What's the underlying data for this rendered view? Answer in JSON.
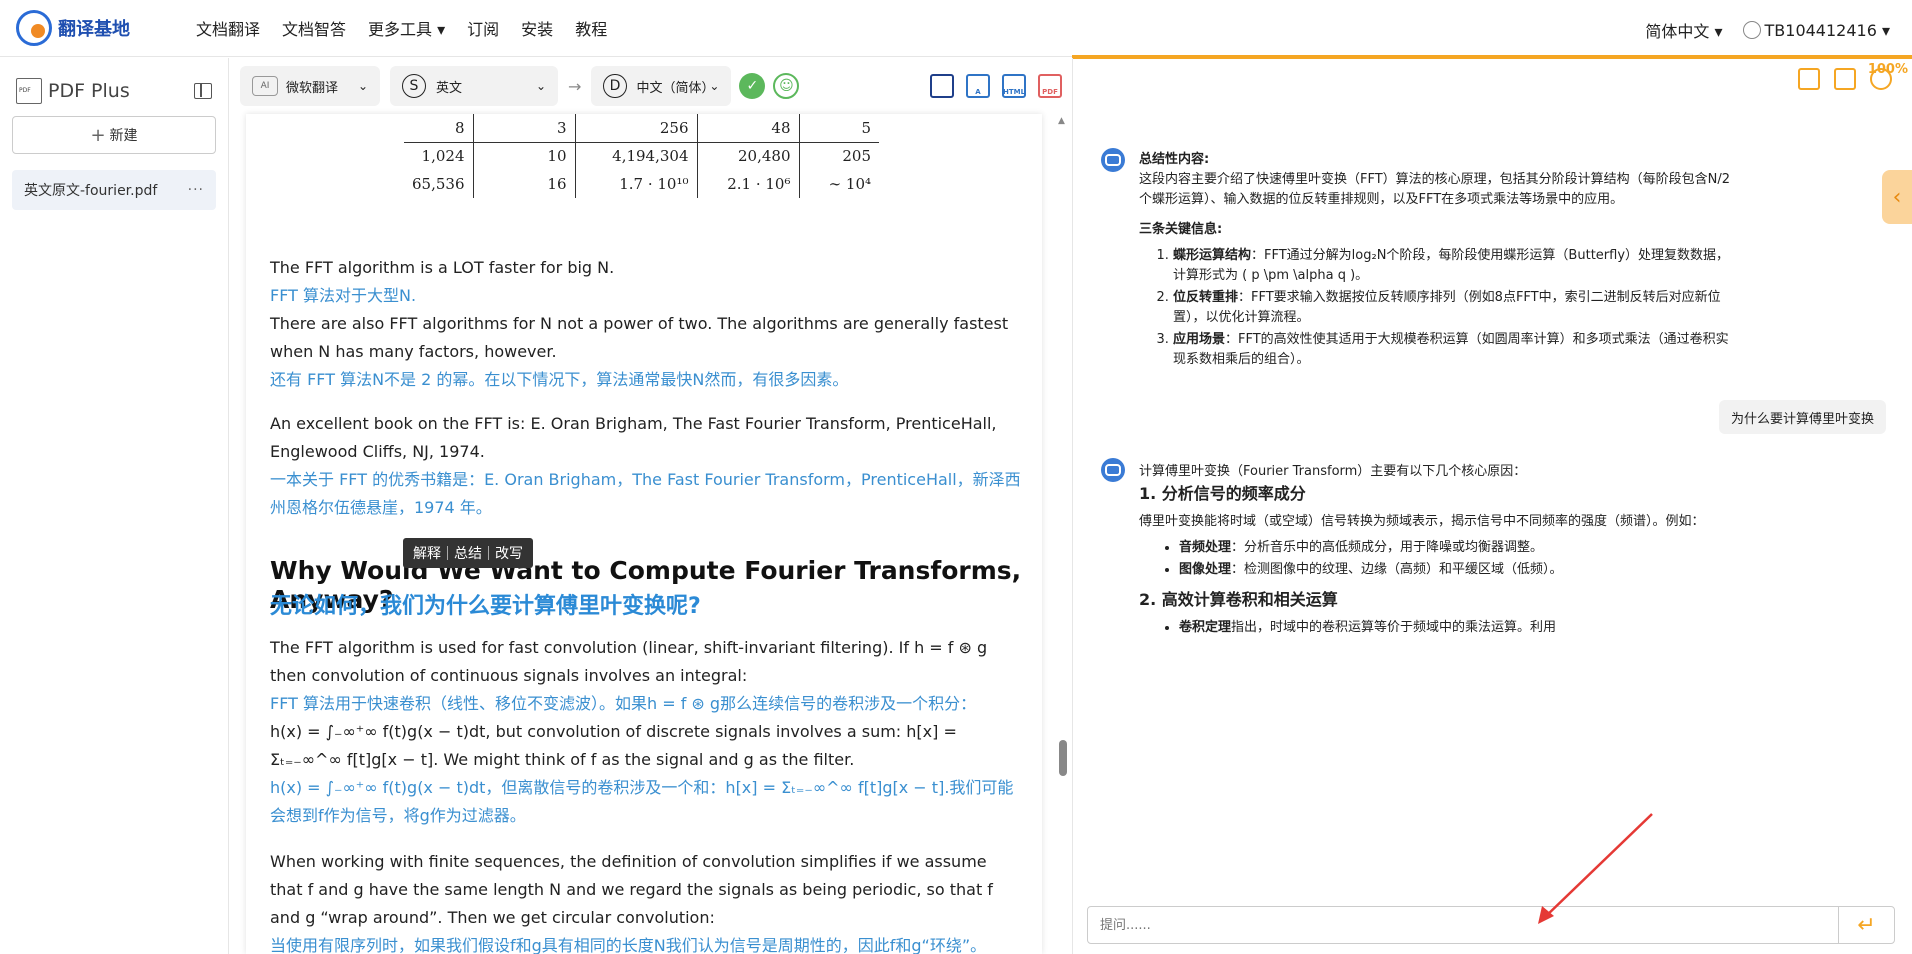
{
  "header": {
    "logo_text": "翻译基地",
    "nav": [
      "文档翻译",
      "文档智答",
      "更多工具 ▾",
      "订阅",
      "安装",
      "教程"
    ],
    "language": "简体中文 ▾",
    "user": "TB104412416 ▾"
  },
  "sidebar": {
    "title": "PDF Plus",
    "new_button": "新建",
    "file": "英文原文-fourier.pdf",
    "file_more": "···"
  },
  "toolbar": {
    "engine": "微软翻译",
    "engine_icon": "AI",
    "source_lang": "英文",
    "source_icon": "S",
    "target_lang": "中文（简体）",
    "target_icon": "D",
    "arrow": "→"
  },
  "doc": {
    "table_rows": [
      [
        "8",
        "3",
        "256",
        "48",
        "5"
      ],
      [
        "1,024",
        "10",
        "4,194,304",
        "20,480",
        "205"
      ],
      [
        "65,536",
        "16",
        "1.7 · 10¹⁰",
        "2.1 · 10⁶",
        "∼ 10⁴"
      ]
    ],
    "p1_en": "The FFT algorithm is a LOT faster for big N.",
    "p1_cn": "FFT 算法对于大型N.",
    "p2_en": "There are also FFT algorithms for N not a power of two. The algorithms are generally fastest when N has many factors, however.",
    "p2_cn": "还有 FFT 算法N不是 2 的幂。在以下情况下，算法通常最快N然而，有很多因素。",
    "p3_en": "An excellent book on the FFT is: E. Oran Brigham, The Fast Fourier Transform, PrenticeHall, Englewood Cliffs, NJ, 1974.",
    "p3_cn": "一本关于 FFT 的优秀书籍是：E. Oran Brigham，The Fast Fourier Transform，PrenticeHall，新泽西州恩格尔伍德悬崖，1974 年。",
    "context_menu": [
      "解释",
      "总结",
      "改写"
    ],
    "heading_en": "Why Would We Want to Compute Fourier Transforms, Anyway?",
    "heading_cn": "无论如何，我们为什么要计算傅里叶变换呢?",
    "p4_en": "The FFT algorithm is used for fast convolution (linear, shift-invariant filtering). If h = f ⊛ g then convolution of continuous signals involves an integral:",
    "p4_cn": "FFT 算法用于快速卷积（线性、移位不变滤波）。如果h = f ⊛ g那么连续信号的卷积涉及一个积分：",
    "p5_en": "h(x) = ∫₋∞⁺∞ f(t)g(x − t)dt, but convolution of discrete signals involves a sum: h[x] = Σₜ₌₋∞^∞ f[t]g[x − t]. We might think of f as the signal and g as the filter.",
    "p5_cn": "h(x) = ∫₋∞⁺∞ f(t)g(x − t)dt，但离散信号的卷积涉及一个和：h[x] = Σₜ₌₋∞^∞ f[t]g[x − t].我们可能会想到f作为信号，将g作为过滤器。",
    "p6_en": "When working with finite sequences, the definition of convolution simplifies if we assume that f and g have the same length N and we regard the signals as being periodic, so that f and g “wrap around”. Then we get circular convolution:",
    "p6_cn": "当使用有限序列时，如果我们假设f和g具有相同的长度N我们认为信号是周期性的，因此f和g“环绕”。"
  },
  "chat": {
    "percent": "100%",
    "m1_summary_title": "总结性内容:",
    "m1_summary": "这段内容主要介绍了快速傅里叶变换（FFT）算法的核心原理，包括其分阶段计算结构（每阶段包含N/2个蝶形运算）、输入数据的位反转重排规则，以及FFT在多项式乘法等场景中的应用。",
    "m1_key_title": "三条关键信息:",
    "m1_items": [
      {
        "k": "蝶形运算结构",
        "v": "：FFT通过分解为log₂N个阶段，每阶段使用蝶形运算（Butterfly）处理复数数据，计算形式为 ( p \\pm \\alpha q )。"
      },
      {
        "k": "位反转重排",
        "v": "：FFT要求输入数据按位反转顺序排列（例如8点FFT中，索引二进制反转后对应新位置），以优化计算流程。"
      },
      {
        "k": "应用场景",
        "v": "：FFT的高效性使其适用于大规模卷积运算（如圆周率计算）和多项式乘法（通过卷积实现系数相乘后的组合）。"
      }
    ],
    "user_question": "为什么要计算傅里叶变换",
    "m2_intro": "计算傅里叶变换（Fourier Transform）主要有以下几个核心原因：",
    "m2_h1": "1. 分析信号的频率成分",
    "m2_p1": "傅里叶变换能将时域（或空域）信号转换为频域表示，揭示信号中不同频率的强度（频谱）。例如：",
    "m2_b1": [
      {
        "k": "音频处理",
        "v": "：分析音乐中的高低频成分，用于降噪或均衡器调整。"
      },
      {
        "k": "图像处理",
        "v": "：检测图像中的纹理、边缘（高频）和平缓区域（低频）。"
      }
    ],
    "m2_h2": "2. 高效计算卷积和相关运算",
    "m2_b2": [
      {
        "k": "卷积定理",
        "v": "指出，时域中的卷积运算等价于频域中的乘法运算。利用"
      }
    ],
    "input_placeholder": "提问......",
    "send_icon": "↵"
  },
  "colors": {
    "accent": "#f5a623",
    "translation": "#3a8fd0",
    "brand": "#1f4fb0"
  }
}
